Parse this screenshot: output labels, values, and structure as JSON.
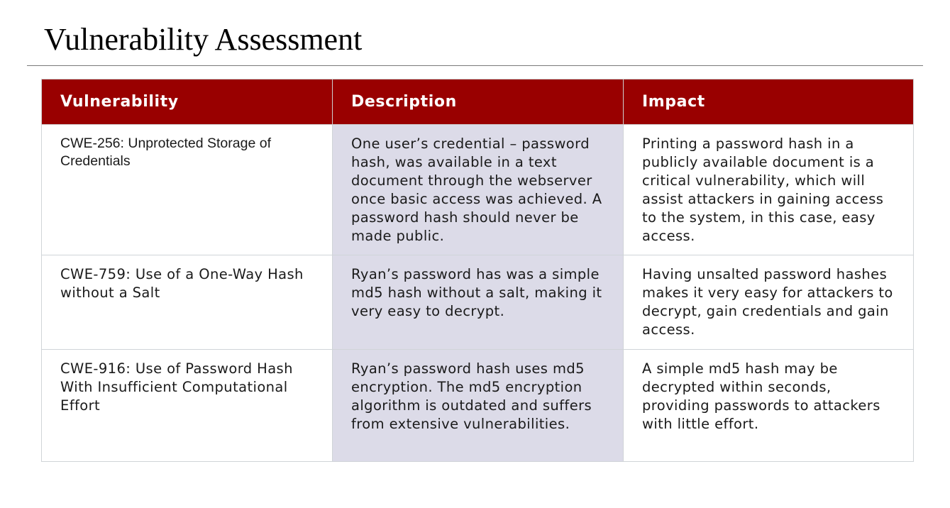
{
  "title": "Vulnerability Assessment",
  "table": {
    "headers": [
      "Vulnerability",
      "Description",
      "Impact"
    ],
    "rows": [
      {
        "vulnerability": "CWE-256: Unprotected Storage of Credentials",
        "description": "One user’s credential – password hash, was available in a text document through the webserver once basic access was achieved. A password hash should never be made public.",
        "impact": "Printing a password hash in a publicly available document is a critical vulnerability, which will assist attackers in gaining access to the system, in this case, easy access."
      },
      {
        "vulnerability": "CWE-759: Use of a One-Way Hash without a Salt",
        "description": "Ryan’s password has was a simple md5 hash without a salt, making it very easy to decrypt.",
        "impact": "Having unsalted password hashes makes it very easy for attackers to decrypt, gain credentials and gain access."
      },
      {
        "vulnerability": "CWE-916: Use of Password Hash With Insufficient Computational Effort",
        "description": "Ryan’s password hash uses md5 encryption. The md5 encryption algorithm is outdated and suffers from extensive vulnerabilities.",
        "impact": "A simple md5 hash may be decrypted within seconds, providing passwords to attackers with little effort."
      }
    ]
  },
  "colors": {
    "header_background": "#990000",
    "description_column_background": "#dcdbe8"
  }
}
